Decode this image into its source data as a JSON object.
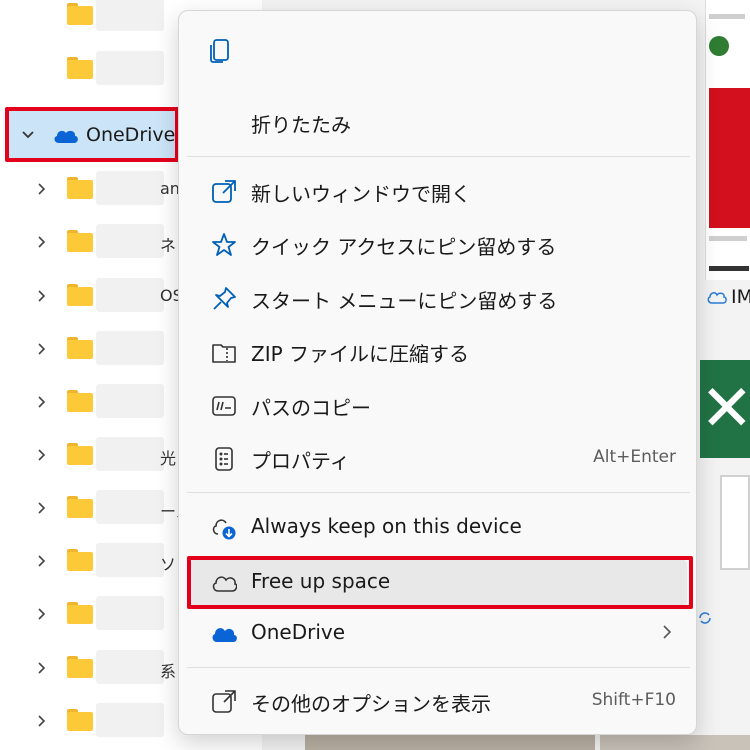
{
  "nav": {
    "onedrive_label": "OneDrive",
    "fragments": [
      "an",
      "ネ",
      "OS",
      "",
      "",
      "光",
      "ール",
      "ソト",
      "",
      "系",
      ""
    ]
  },
  "background": {
    "im_label": "IM"
  },
  "menu": {
    "collapse": "折りたたみ",
    "open_new_window": "新しいウィンドウで開く",
    "pin_quick_access": "クイック アクセスにピン留めする",
    "pin_start": "スタート メニューにピン留めする",
    "zip": "ZIP ファイルに圧縮する",
    "copy_path": "パスのコピー",
    "properties": "プロパティ",
    "properties_shortcut": "Alt+Enter",
    "always_keep": "Always keep on this device",
    "free_up": "Free up space",
    "onedrive": "OneDrive",
    "more_options": "その他のオプションを表示",
    "more_options_shortcut": "Shift+F10"
  },
  "colors": {
    "accent": "#005fb8",
    "highlight_frame": "#e3001b",
    "folder": "#fcc938",
    "onedrive_blue": "#0a64d6",
    "selection": "#cce4f7"
  }
}
